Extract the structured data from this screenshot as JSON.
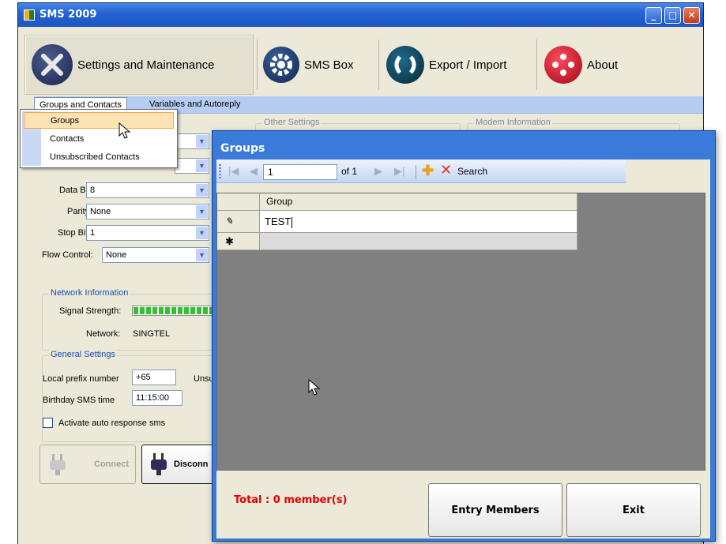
{
  "window": {
    "title": "SMS 2009",
    "controls": {
      "minimize": "_",
      "maximize": "□",
      "close": "✕"
    }
  },
  "toolbar": {
    "items": [
      {
        "label": "Settings and Maintenance",
        "icon": "tools-icon"
      },
      {
        "label": "SMS Box",
        "icon": "gear-icon"
      },
      {
        "label": "Export / Import",
        "icon": "transfer-icon"
      },
      {
        "label": "About",
        "icon": "about-icon"
      }
    ]
  },
  "menu": {
    "items": [
      "Groups and Contacts",
      "Variables and Autoreply"
    ],
    "dropdown": [
      "Groups",
      "Contacts",
      "Unsubscribed Contacts"
    ]
  },
  "sections": {
    "other_settings": "Other Settings",
    "modem_information": "Modem Information"
  },
  "port_settings": {
    "data_bits_label": "Data Bits:",
    "data_bits": "8",
    "parity_label": "Parity:",
    "parity": "None",
    "stop_bits_label": "Stop Bits:",
    "stop_bits": "1",
    "flow_control_label": "Flow Control:",
    "flow_control": "None"
  },
  "network": {
    "title": "Network Information",
    "signal_label": "Signal Strength:",
    "network_label": "Network:",
    "network_value": "SINGTEL"
  },
  "general": {
    "title": "General Settings",
    "prefix_label": "Local prefix number",
    "prefix_value": "+65",
    "unsub_label": "Unsu",
    "birthday_label": "Birthday SMS time",
    "birthday_value": "11:15:00",
    "auto_response_label": "Activate auto response sms"
  },
  "connection": {
    "connect": "Connect",
    "disconnect": "Disconn"
  },
  "groups_dialog": {
    "title": "Groups",
    "nav": {
      "position": "1",
      "of": "of 1",
      "search": "Search"
    },
    "grid": {
      "column": "Group",
      "rows": [
        {
          "indicator": "✎",
          "value": "TEST"
        }
      ],
      "new_row_indicator": "✱"
    },
    "total": "Total : 0 member(s)",
    "entry_button": "Entry Members",
    "exit_button": "Exit"
  },
  "colors": {
    "title_bar": "#2463d3",
    "menu_strip": "#b5cdf2",
    "grid_bg": "#808080",
    "total_text": "#e00000"
  }
}
